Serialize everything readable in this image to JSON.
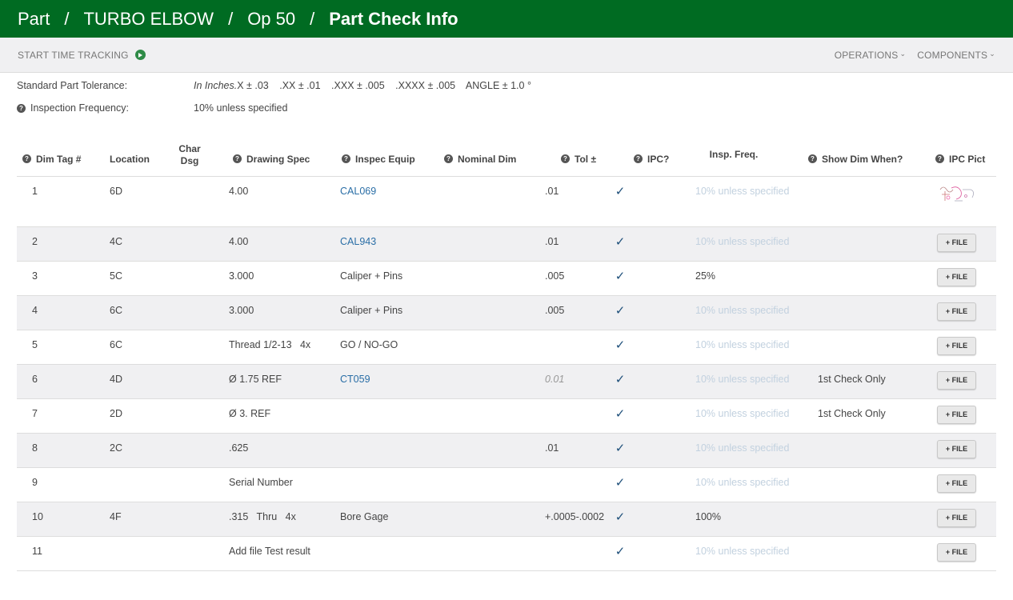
{
  "breadcrumb": [
    "Part",
    "TURBO ELBOW",
    "Op 50",
    "Part Check Info"
  ],
  "toolbar": {
    "time_tracking": "START TIME TRACKING",
    "operations": "OPERATIONS",
    "components": "COMPONENTS"
  },
  "meta": {
    "tolerance_label": "Standard Part Tolerance:",
    "tolerance_units": "In Inches.",
    "tolerance_values": [
      "X  ± .03",
      ".XX  ± .01",
      ".XXX  ± .005",
      ".XXXX  ± .005",
      "ANGLE  ± 1.0 °"
    ],
    "frequency_label": "Inspection Frequency:",
    "frequency_value": "10% unless specified"
  },
  "columns": {
    "dim_tag": "Dim Tag #",
    "location": "Location",
    "char_dsg": "Char Dsg",
    "drawing_spec": "Drawing Spec",
    "inspec_equip": "Inspec Equip",
    "nominal_dim": "Nominal Dim",
    "tol": "Tol ±",
    "ipc": "IPC?",
    "insp_freq": "Insp. Freq.",
    "show_dim": "Show Dim When?",
    "ipc_pict": "IPC Pict"
  },
  "file_button_label": "+ FILE",
  "check_mark": "✓",
  "rows": [
    {
      "tag": "1",
      "location": "6D",
      "spec": "4.00",
      "equip": "CAL069",
      "equip_link": true,
      "tol": ".01",
      "tol_style": "normal",
      "freq": "10% unless specified",
      "freq_default": true,
      "show": "",
      "pict": "thumbnail"
    },
    {
      "tag": "2",
      "location": "4C",
      "spec": "4.00",
      "equip": "CAL943",
      "equip_link": true,
      "tol": ".01",
      "tol_style": "normal",
      "freq": "10% unless specified",
      "freq_default": true,
      "show": "",
      "pict": "button"
    },
    {
      "tag": "3",
      "location": "5C",
      "spec": "3.000",
      "equip": "Caliper + Pins",
      "equip_link": false,
      "tol": ".005",
      "tol_style": "normal",
      "freq": "25%",
      "freq_default": false,
      "show": "",
      "pict": "button"
    },
    {
      "tag": "4",
      "location": "6C",
      "spec": "3.000",
      "equip": "Caliper + Pins",
      "equip_link": false,
      "tol": ".005",
      "tol_style": "normal",
      "freq": "10% unless specified",
      "freq_default": true,
      "show": "",
      "pict": "button"
    },
    {
      "tag": "5",
      "location": "6C",
      "spec": "Thread 1/2-13   4x",
      "equip": "GO / NO-GO",
      "equip_link": false,
      "tol": "",
      "tol_style": "normal",
      "freq": "10% unless specified",
      "freq_default": true,
      "show": "",
      "pict": "button"
    },
    {
      "tag": "6",
      "location": "4D",
      "spec": "Ø 1.75 REF",
      "equip": "CT059",
      "equip_link": true,
      "tol": "0.01",
      "tol_style": "faded",
      "freq": "10% unless specified",
      "freq_default": true,
      "show": "1st Check Only",
      "pict": "button"
    },
    {
      "tag": "7",
      "location": "2D",
      "spec": "Ø 3. REF",
      "equip": "",
      "equip_link": false,
      "tol": "",
      "tol_style": "normal",
      "freq": "10% unless specified",
      "freq_default": true,
      "show": "1st Check Only",
      "pict": "button"
    },
    {
      "tag": "8",
      "location": "2C",
      "spec": ".625",
      "equip": "",
      "equip_link": false,
      "tol": ".01",
      "tol_style": "normal",
      "freq": "10% unless specified",
      "freq_default": true,
      "show": "",
      "pict": "button"
    },
    {
      "tag": "9",
      "location": "",
      "spec": "Serial Number",
      "equip": "",
      "equip_link": false,
      "tol": "",
      "tol_style": "normal",
      "freq": "10% unless specified",
      "freq_default": true,
      "show": "",
      "pict": "button"
    },
    {
      "tag": "10",
      "location": "4F",
      "spec": ".315   Thru   4x",
      "equip": "Bore Gage",
      "equip_link": false,
      "tol": "+.0005-.0002",
      "tol_style": "normal",
      "freq": "100%",
      "freq_default": false,
      "show": "",
      "pict": "button"
    },
    {
      "tag": "11",
      "location": "",
      "spec": "Add file Test result",
      "equip": "",
      "equip_link": false,
      "tol": "",
      "tol_style": "normal",
      "freq": "10% unless specified",
      "freq_default": true,
      "show": "",
      "pict": "button"
    }
  ],
  "colors": {
    "header_bg": "#006b22",
    "link": "#2a6ea6",
    "check": "#1e4f7a",
    "faint_text": "#c2d1df"
  }
}
